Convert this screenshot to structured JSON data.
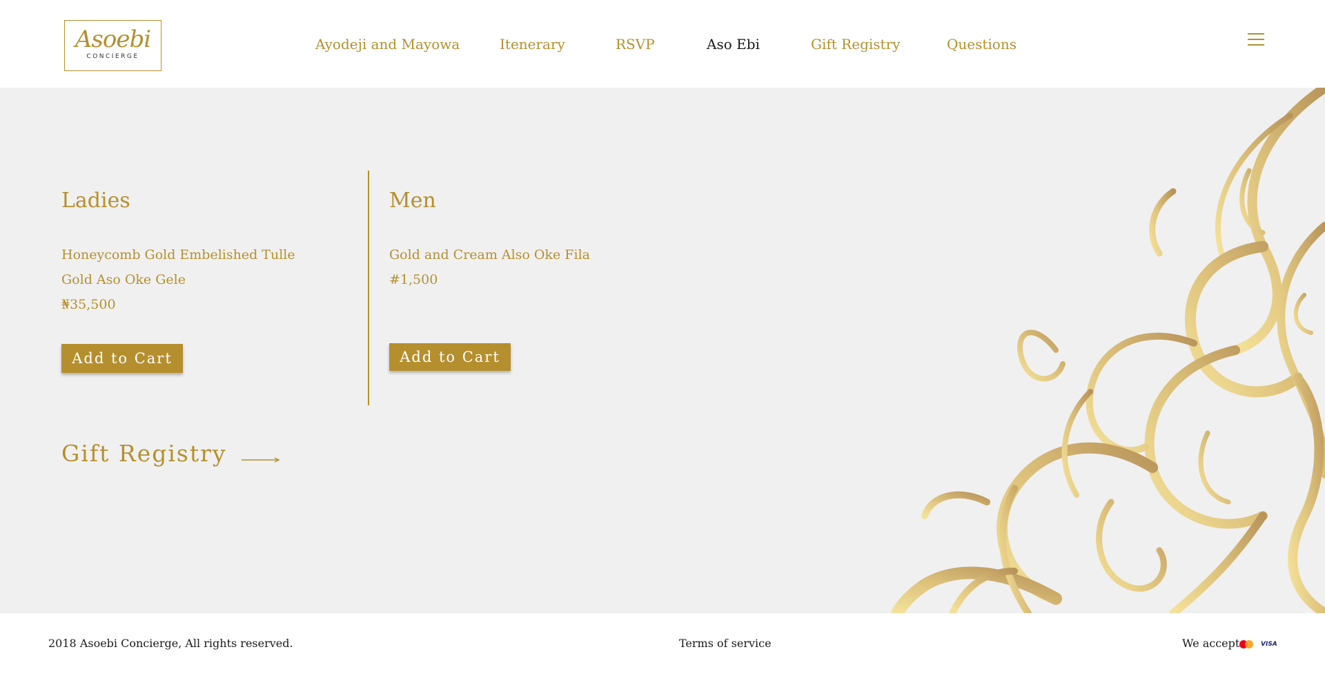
{
  "header": {
    "logo_script": "Asoebi",
    "logo_sub": "CONCIERGE",
    "nav": [
      {
        "label": "Ayodeji and Mayowa",
        "active": false
      },
      {
        "label": "Itenerary",
        "active": false
      },
      {
        "label": "RSVP",
        "active": false
      },
      {
        "label": "Aso Ebi",
        "active": true
      },
      {
        "label": "Gift Registry",
        "active": false
      },
      {
        "label": "Questions",
        "active": false
      }
    ],
    "menu_icon": "hamburger-menu-icon"
  },
  "ladies": {
    "heading": "Ladies",
    "product_line1": "Honeycomb Gold Embelished Tulle",
    "product_line2": "Gold Aso Oke Gele",
    "price": "₦35,500",
    "button": "Add to Cart"
  },
  "men": {
    "heading": "Men",
    "product": "Gold and Cream Also Oke Fila",
    "price": "#1,500",
    "button": "Add to Cart"
  },
  "gift_registry": {
    "label": "Gift Registry",
    "arrow_icon": "arrow-right-icon"
  },
  "footer": {
    "copyright": "2018 Asoebi Concierge, All rights reserved.",
    "terms": "Terms of service",
    "we_accept": "We accept:",
    "payment_icons": [
      "mastercard-icon",
      "visa-icon"
    ],
    "visa_text": "VISA"
  },
  "colors": {
    "gold": "#b58f2e",
    "background": "#f0f0f0",
    "text_dark": "#1a1a1a"
  }
}
